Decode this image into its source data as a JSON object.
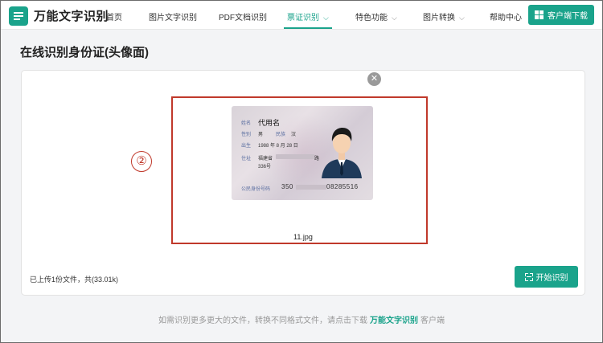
{
  "header": {
    "brand": "万能文字识别",
    "nav": [
      {
        "label": "首页"
      },
      {
        "label": "图片文字识别"
      },
      {
        "label": "PDF文档识别"
      },
      {
        "label": "票证识别"
      },
      {
        "label": "特色功能"
      },
      {
        "label": "图片转换"
      },
      {
        "label": "帮助中心"
      }
    ],
    "download_label": "客户端下载",
    "accent": "#1aa38b"
  },
  "page": {
    "title": "在线识别身份证(头像面)"
  },
  "card": {
    "label_name": "姓名",
    "name": "代用名",
    "label_sex": "性别",
    "sex": "男",
    "label_nation": "民族",
    "nation": "汉",
    "label_birth": "出生",
    "birth": "1988 年 8 月 28 日",
    "label_address": "住址",
    "address_1": "福建省",
    "address_tail": "路",
    "address_2": "336号",
    "label_id": "公民身份号码",
    "id_prefix": "350",
    "id_suffix": "08285516"
  },
  "file": {
    "name": "11.jpg"
  },
  "annotation": {
    "marker": "②",
    "color": "#c0392b"
  },
  "upload": {
    "summary": "已上传1份文件，共(33.01k)"
  },
  "actions": {
    "start_label": "开始识别"
  },
  "footer": {
    "text_before": "如需识别更多更大的文件，转换不同格式文件，请点击下载",
    "brand_link": "万能文字识别",
    "text_after": "客户端"
  }
}
